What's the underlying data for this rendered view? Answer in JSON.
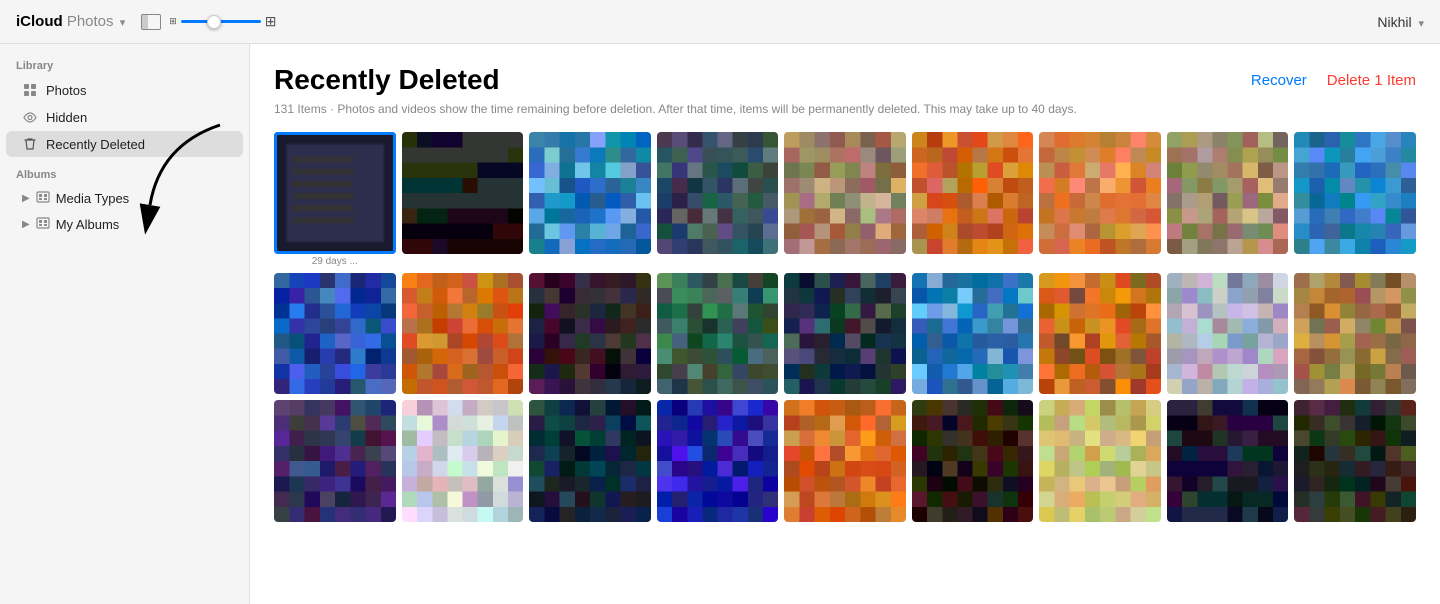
{
  "app": {
    "title_icloud": "iCloud",
    "title_photos": "Photos",
    "title_chevron": "▾",
    "user": "Nikhil",
    "user_chevron": "▾"
  },
  "topbar": {
    "sidebar_toggle_label": "Toggle Sidebar",
    "zoom_min": 0,
    "zoom_max": 100,
    "zoom_value": 40
  },
  "sidebar": {
    "library_label": "Library",
    "items": [
      {
        "id": "photos",
        "label": "Photos",
        "icon": "grid"
      },
      {
        "id": "hidden",
        "label": "Hidden",
        "icon": "eye-off"
      },
      {
        "id": "recently-deleted",
        "label": "Recently Deleted",
        "icon": "trash",
        "active": true
      }
    ],
    "albums_label": "Albums",
    "groups": [
      {
        "id": "media-types",
        "label": "Media Types"
      },
      {
        "id": "my-albums",
        "label": "My Albums"
      }
    ]
  },
  "content": {
    "title": "Recently Deleted",
    "subtitle": "131 Items  ·  Photos and videos show the time remaining before deletion. After that time, items will be permanently deleted. This may take up to 40 days.",
    "recover_btn": "Recover",
    "delete_btn": "Delete 1 Item",
    "first_photo_label": "29 days ..."
  },
  "photos": {
    "row1_colors": [
      [
        "#1a1a2e",
        "#2d2d3e",
        "#333355",
        "#1a1a2e"
      ],
      [
        "#111",
        "#1a1a1a",
        "#222",
        "#111"
      ],
      [
        "#1a6fa8",
        "#2980b9",
        "#6aafe6",
        "#1a6fa8"
      ],
      [
        "#2c3e50",
        "#34495e",
        "#4a6278",
        "#2c3e50"
      ],
      [
        "#8b7355",
        "#a0856a",
        "#c4a882",
        "#8b7355"
      ],
      [
        "#c75b1a",
        "#e67e22",
        "#c0844d",
        "#c75b1a"
      ],
      [
        "#d4813a",
        "#e8935a",
        "#c47040",
        "#d4813a"
      ],
      [
        "#8b7355",
        "#a0856a",
        "#c4a882",
        "#8b7355"
      ],
      [
        "#1a6fa8",
        "#2980b9",
        "#4a90d9",
        "#1a6fa8"
      ]
    ],
    "row2_colors": [
      [
        "#1a3a8a",
        "#2550b0",
        "#3a6ad4",
        "#1a3a8a"
      ],
      [
        "#c75b1a",
        "#e67e22",
        "#b06030",
        "#c75b1a"
      ],
      [
        "#2c1a2e",
        "#3d2040",
        "#1a1020",
        "#2c1a2e"
      ],
      [
        "#2c5a4a",
        "#3d7a62",
        "#204535",
        "#2c5a4a"
      ],
      [
        "#1a2a3a",
        "#253545",
        "#3a4f62",
        "#1a2a3a"
      ],
      [
        "#1a6fa8",
        "#2980b9",
        "#6aafe6",
        "#1a6fa8"
      ],
      [
        "#c75b1a",
        "#e67e22",
        "#8b5520",
        "#c75b1a"
      ],
      [
        "#c0c0d0",
        "#a8a8c0",
        "#9090b0",
        "#c0c0d0"
      ],
      [
        "#8b6a40",
        "#a07848",
        "#c0944e",
        "#8b6a40"
      ]
    ],
    "row3_colors": [
      [
        "#3a3060",
        "#4a4080",
        "#2a2050",
        "#3a3060"
      ],
      [
        "#c8c8d0",
        "#e0e0e8",
        "#a8a8b8",
        "#c8c8d0"
      ],
      [
        "#0a2a3a",
        "#103a4a",
        "#0a1a2a",
        "#0a2a3a"
      ],
      [
        "#1a1a8a",
        "#2020b0",
        "#3030d4",
        "#1a1a8a"
      ],
      [
        "#c75b1a",
        "#e67e22",
        "#d4813a",
        "#c75b1a"
      ],
      [
        "#2c1a10",
        "#3d2015",
        "#1a100a",
        "#2c1a10"
      ],
      [
        "#c8b870",
        "#d4c880",
        "#b8a860",
        "#c8b870"
      ],
      [
        "#1a1a2e",
        "#2d2d3e",
        "#111",
        "#1a1a2e"
      ],
      [
        "#2c3020",
        "#3d4030",
        "#1a2010",
        "#2c3020"
      ]
    ]
  }
}
